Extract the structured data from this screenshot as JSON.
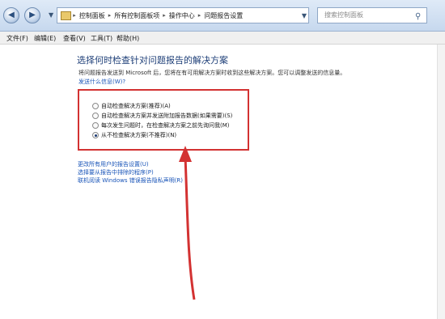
{
  "window": {
    "nav": {
      "back_icon": "back-arrow-icon",
      "forward_icon": "forward-arrow-icon"
    },
    "breadcrumb": [
      "控制面板",
      "所有控制面板项",
      "操作中心",
      "问题报告设置"
    ],
    "search_placeholder": "搜索控制面板"
  },
  "menu": {
    "file": "文件(F)",
    "edit": "编辑(E)",
    "view": "查看(V)",
    "tools": "工具(T)",
    "help": "帮助(H)"
  },
  "main": {
    "heading": "选择何时检查针对问题报告的解决方案",
    "description": "将问题报告发送到 Microsoft 后，您将在有可用解决方案时收到这些解决方案。您可以调整发送的信息量。",
    "why_link": "发送什么信息(W)?",
    "options": [
      {
        "label": "自动检查解决方案(推荐)(A)",
        "selected": false
      },
      {
        "label": "自动检查解决方案并发送附加报告数据(如果需要)(S)",
        "selected": false
      },
      {
        "label": "每次发生问题时，在检查解决方案之前先询问我(M)",
        "selected": false
      },
      {
        "label": "从不检查解决方案(不推荐)(N)",
        "selected": true
      }
    ],
    "links": [
      "更改所有用户的报告设置(U)",
      "选择要从报告中排除的程序(P)",
      "联机阅读 Windows 错误报告隐私声明(R)"
    ]
  },
  "colors": {
    "highlight": "#d33232",
    "link": "#1a55b8",
    "heading": "#1e3f78"
  }
}
